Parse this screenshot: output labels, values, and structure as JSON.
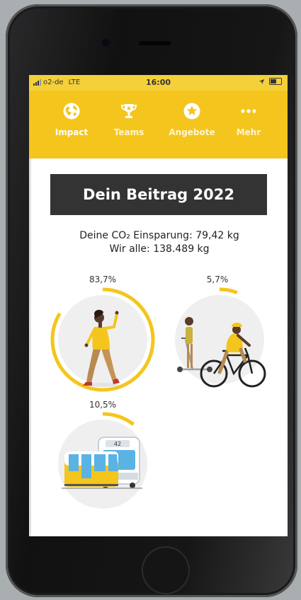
{
  "status_bar": {
    "carrier": "o2-de",
    "network": "LTE",
    "time": "16:00"
  },
  "nav": {
    "items": [
      {
        "label": "Impact",
        "icon": "globe-icon",
        "active": true
      },
      {
        "label": "Teams",
        "icon": "trophy-icon",
        "active": false
      },
      {
        "label": "Angebote",
        "icon": "star-badge-icon",
        "active": false
      },
      {
        "label": "Mehr",
        "icon": "more-dots-icon",
        "active": false
      }
    ]
  },
  "main": {
    "title": "Dein Beitrag 2022",
    "co2_label": "Deine CO₂ Einsparung: 79,42 kg",
    "total_label": "Wir alle: 138.489 kg",
    "modes": [
      {
        "name": "walking",
        "percent_label": "83,7%",
        "fraction": 0.837
      },
      {
        "name": "bike-scooter",
        "percent_label": "5,7%",
        "fraction": 0.057
      },
      {
        "name": "public-transport",
        "percent_label": "10,5%",
        "fraction": 0.105
      }
    ]
  },
  "colors": {
    "accent_yellow": "#f4c51d",
    "title_bg": "#333333",
    "circle_bg": "#efefef"
  }
}
